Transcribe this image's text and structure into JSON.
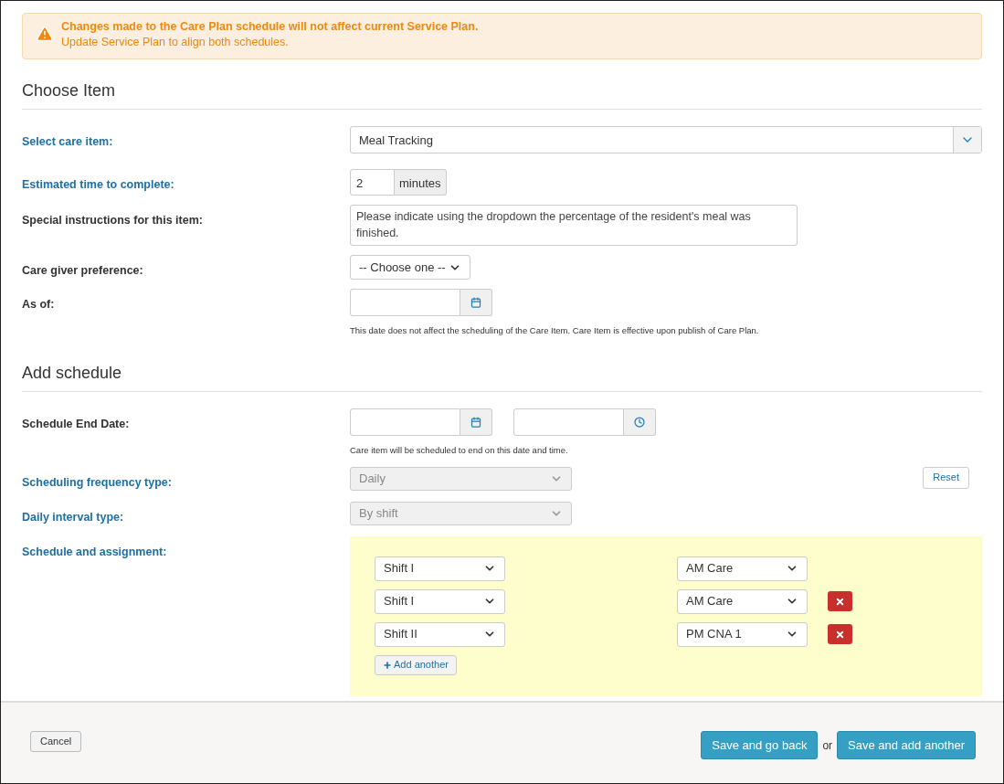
{
  "alert": {
    "title": "Changes made to the Care Plan schedule will not affect current Service Plan.",
    "message": "Update Service Plan to align both schedules."
  },
  "choose_item": {
    "heading": "Choose Item",
    "care_item": {
      "label": "Select care item:",
      "highlighted": true,
      "value": "Meal Tracking"
    },
    "estimated_time": {
      "label": "Estimated time to complete:",
      "highlighted": true,
      "value": "2",
      "unit": "minutes"
    },
    "special_instructions": {
      "label": "Special instructions for this item:",
      "highlighted": false,
      "value": "Please indicate using the dropdown the percentage of the resident's meal was finished."
    },
    "care_giver": {
      "label": "Care giver preference:",
      "highlighted": false,
      "value": "-- Choose one --"
    },
    "as_of": {
      "label": "As of:",
      "highlighted": false,
      "help": "This date does not affect the scheduling of the Care Item. Care Item is effective upon publish of Care Plan."
    }
  },
  "add_schedule": {
    "heading": "Add schedule",
    "end_date": {
      "label": "Schedule End Date:",
      "highlighted": false,
      "help": "Care item will be scheduled to end on this date and time."
    },
    "frequency": {
      "label": "Scheduling frequency type:",
      "highlighted": true,
      "value": "Daily",
      "disabled": true,
      "reset": "Reset"
    },
    "interval": {
      "label": "Daily interval type:",
      "highlighted": true,
      "value": "By shift",
      "disabled": true
    },
    "assignment": {
      "label": "Schedule and assignment:",
      "highlighted": true,
      "rows": [
        {
          "shift": "Shift I",
          "assignee": "AM Care",
          "removable": false
        },
        {
          "shift": "Shift I",
          "assignee": "AM Care",
          "removable": true
        },
        {
          "shift": "Shift II",
          "assignee": "PM CNA 1",
          "removable": true
        }
      ],
      "add": "Add another"
    }
  },
  "footer": {
    "cancel": "Cancel",
    "save_back": "Save and go back",
    "or": "or",
    "save_add": "Save and add another"
  }
}
